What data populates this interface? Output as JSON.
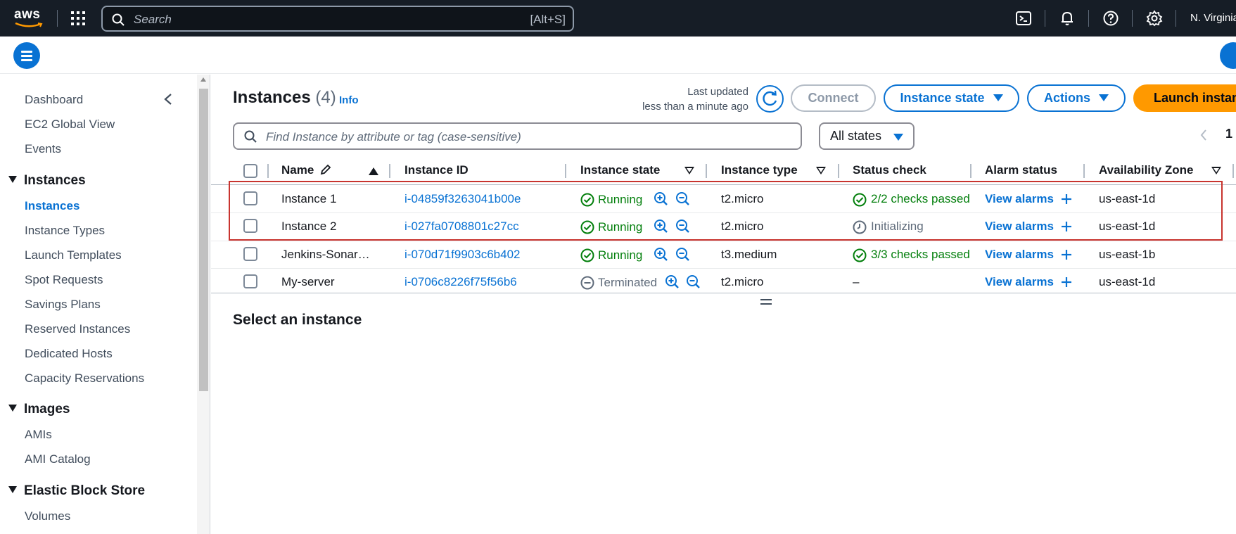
{
  "topbar": {
    "logo_text": "aws",
    "search_placeholder": "Search",
    "search_shortcut": "[Alt+S]",
    "region": "N. Virginia",
    "icons": [
      "grid-icon",
      "cloudshell-icon",
      "bell-icon",
      "help-icon",
      "gear-icon"
    ]
  },
  "sidebar": {
    "items_top": [
      "Dashboard",
      "EC2 Global View",
      "Events"
    ],
    "sections": [
      {
        "title": "Instances",
        "items": [
          "Instances",
          "Instance Types",
          "Launch Templates",
          "Spot Requests",
          "Savings Plans",
          "Reserved Instances",
          "Dedicated Hosts",
          "Capacity Reservations"
        ]
      },
      {
        "title": "Images",
        "items": [
          "AMIs",
          "AMI Catalog"
        ]
      },
      {
        "title": "Elastic Block Store",
        "items": [
          "Volumes"
        ]
      }
    ],
    "active_item": "Instances"
  },
  "main": {
    "title": "Instances",
    "count": "(4)",
    "info": "Info",
    "last_updated_label": "Last updated",
    "last_updated_value": "less than a minute ago",
    "connect_label": "Connect",
    "instance_state_label": "Instance state",
    "actions_label": "Actions",
    "launch_label": "Launch instance",
    "find_placeholder": "Find Instance by attribute or tag (case-sensitive)",
    "states_filter": "All states",
    "page_number": "1",
    "select_prompt": "Select an instance"
  },
  "table": {
    "columns": [
      "Name",
      "Instance ID",
      "Instance state",
      "Instance type",
      "Status check",
      "Alarm status",
      "Availability Zone"
    ],
    "rows": [
      {
        "name": "Instance 1",
        "id": "i-04859f3263041b00e",
        "state": "Running",
        "type": "t2.micro",
        "status": "2/2 checks passed",
        "status_kind": "ok",
        "alarm": "View alarms",
        "az": "us-east-1d"
      },
      {
        "name": "Instance 2",
        "id": "i-027fa0708801c27cc",
        "state": "Running",
        "type": "t2.micro",
        "status": "Initializing",
        "status_kind": "pending",
        "alarm": "View alarms",
        "az": "us-east-1d"
      },
      {
        "name": "Jenkins-Sonar…",
        "id": "i-070d71f9903c6b402",
        "state": "Running",
        "type": "t3.medium",
        "status": "3/3 checks passed",
        "status_kind": "ok",
        "alarm": "View alarms",
        "az": "us-east-1b"
      },
      {
        "name": "My-server",
        "id": "i-0706c8226f75f56b6",
        "state": "Terminated",
        "type": "t2.micro",
        "status": "–",
        "status_kind": "none",
        "alarm": "View alarms",
        "az": "us-east-1d"
      }
    ]
  },
  "colors": {
    "accent": "#0972d3",
    "launch": "#ff9900",
    "running": "#037f0c",
    "highlight": "#c8342f",
    "topbar": "#161d26"
  }
}
